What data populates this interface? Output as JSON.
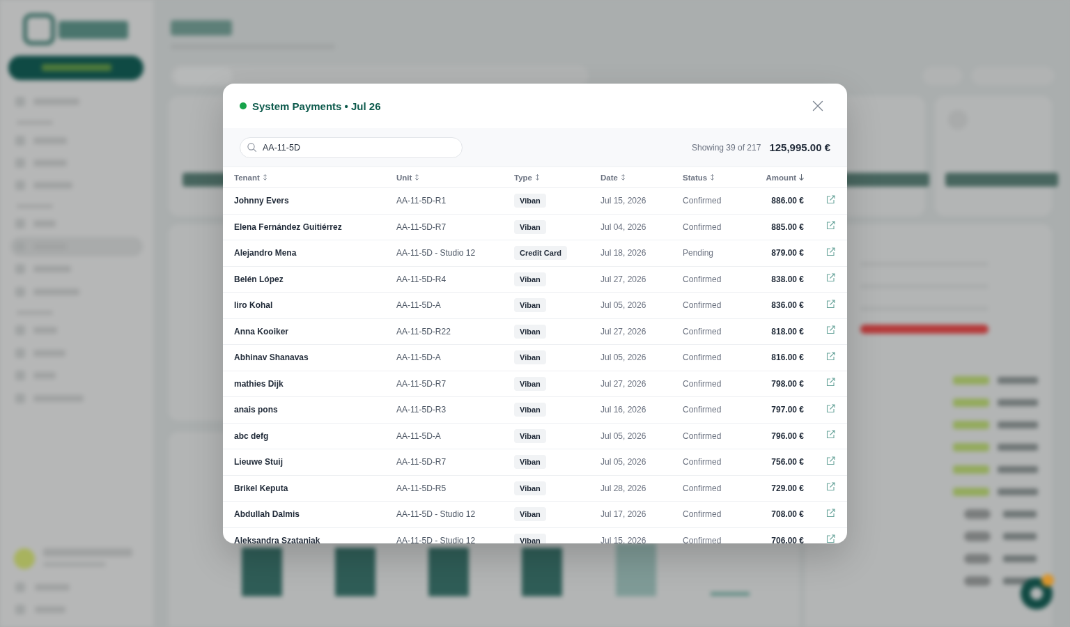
{
  "dialog": {
    "title": "System Payments • Jul 26",
    "search": {
      "value": "AA-11-5D"
    },
    "summary": {
      "count": "Showing 39 of 217",
      "total": "125,995.00 €"
    },
    "table": {
      "columns": [
        {
          "label": "Tenant",
          "sorted": false
        },
        {
          "label": "Unit",
          "sorted": false
        },
        {
          "label": "Type",
          "sorted": false
        },
        {
          "label": "Date",
          "sorted": false
        },
        {
          "label": "Status",
          "sorted": false
        },
        {
          "label": "Amount",
          "sorted": true
        }
      ],
      "rows": [
        {
          "tenant": "Johnny Evers",
          "unit": "AA-11-5D-R1",
          "type": "Viban",
          "date": "Jul 15, 2026",
          "status": "Confirmed",
          "amount": "886.00 €"
        },
        {
          "tenant": "Elena Fernández Guitiérrez",
          "unit": "AA-11-5D-R7",
          "type": "Viban",
          "date": "Jul 04, 2026",
          "status": "Confirmed",
          "amount": "885.00 €"
        },
        {
          "tenant": "Alejandro Mena",
          "unit": "AA-11-5D - Studio 12",
          "type": "Credit Card",
          "date": "Jul 18, 2026",
          "status": "Pending",
          "amount": "879.00 €"
        },
        {
          "tenant": "Belén López",
          "unit": "AA-11-5D-R4",
          "type": "Viban",
          "date": "Jul 27, 2026",
          "status": "Confirmed",
          "amount": "838.00 €"
        },
        {
          "tenant": "Iiro Kohal",
          "unit": "AA-11-5D-A",
          "type": "Viban",
          "date": "Jul 05, 2026",
          "status": "Confirmed",
          "amount": "836.00 €"
        },
        {
          "tenant": "Anna Kooiker",
          "unit": "AA-11-5D-R22",
          "type": "Viban",
          "date": "Jul 27, 2026",
          "status": "Confirmed",
          "amount": "818.00 €"
        },
        {
          "tenant": "Abhinav Shanavas",
          "unit": "AA-11-5D-A",
          "type": "Viban",
          "date": "Jul 05, 2026",
          "status": "Confirmed",
          "amount": "816.00 €"
        },
        {
          "tenant": "mathies Dijk",
          "unit": "AA-11-5D-R7",
          "type": "Viban",
          "date": "Jul 27, 2026",
          "status": "Confirmed",
          "amount": "798.00 €"
        },
        {
          "tenant": "anais pons",
          "unit": "AA-11-5D-R3",
          "type": "Viban",
          "date": "Jul 16, 2026",
          "status": "Confirmed",
          "amount": "797.00 €"
        },
        {
          "tenant": "abc defg",
          "unit": "AA-11-5D-A",
          "type": "Viban",
          "date": "Jul 05, 2026",
          "status": "Confirmed",
          "amount": "796.00 €"
        },
        {
          "tenant": "Lieuwe Stuij",
          "unit": "AA-11-5D-R7",
          "type": "Viban",
          "date": "Jul 05, 2026",
          "status": "Confirmed",
          "amount": "756.00 €"
        },
        {
          "tenant": "Brikel Keputa",
          "unit": "AA-11-5D-R5",
          "type": "Viban",
          "date": "Jul 28, 2026",
          "status": "Confirmed",
          "amount": "729.00 €"
        },
        {
          "tenant": "Abdullah Dalmis",
          "unit": "AA-11-5D - Studio 12",
          "type": "Viban",
          "date": "Jul 17, 2026",
          "status": "Confirmed",
          "amount": "708.00 €"
        },
        {
          "tenant": "Aleksandra Szataniak",
          "unit": "AA-11-5D - Studio 12",
          "type": "Viban",
          "date": "Jul 15, 2026",
          "status": "Confirmed",
          "amount": "706.00 €"
        }
      ]
    }
  }
}
